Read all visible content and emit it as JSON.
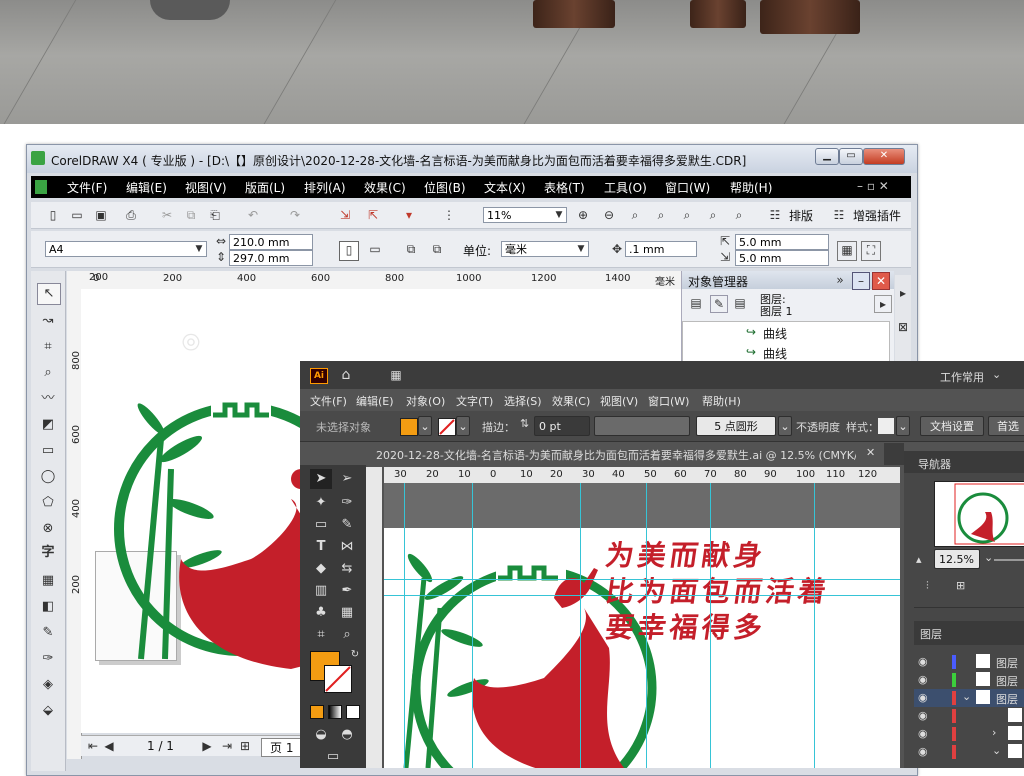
{
  "corel": {
    "title": "CorelDRAW X4 ( 专业版 ) - [D:\\【】原创设计\\2020-12-28-文化墙-名言标语-为美而献身比为面包而活着要幸福得多爱默生.CDR]",
    "menu": [
      "文件(F)",
      "编辑(E)",
      "视图(V)",
      "版面(L)",
      "排列(A)",
      "效果(C)",
      "位图(B)",
      "文本(X)",
      "表格(T)",
      "工具(O)",
      "窗口(W)",
      "帮助(H)"
    ],
    "zoom": "11%",
    "arrange_label": "排版",
    "plugin_label": "增强插件",
    "page_size": "A4",
    "width": "210.0 mm",
    "height": "297.0 mm",
    "unit_label": "单位:",
    "unit_value": "毫米",
    "nudge": ".1 mm",
    "dup_x": "5.0 mm",
    "dup_y": "5.0 mm",
    "ruler_ticks": [
      "200",
      "0",
      "200",
      "400",
      "600",
      "800",
      "1000",
      "1200",
      "1400",
      "毫米"
    ],
    "ruler_v_ticks": [
      "800",
      "600",
      "400",
      "200"
    ],
    "text_tool": "字",
    "page_status": "1 / 1",
    "page_tab": "页 1",
    "docker": {
      "title": "对象管理器",
      "layer_line1": "图层:",
      "layer_line2": "图层 1",
      "items": [
        "曲线",
        "曲线"
      ]
    }
  },
  "ai": {
    "logo": "Ai",
    "workspace": "工作常用",
    "menu": [
      "文件(F)",
      "编辑(E)",
      "对象(O)",
      "文字(T)",
      "选择(S)",
      "效果(C)",
      "视图(V)",
      "窗口(W)",
      "帮助(H)"
    ],
    "no_selection": "未选择对象",
    "stroke_label": "描边：",
    "stroke_value": "0 pt",
    "brush": "5 点圆形",
    "opacity_label": "不透明度",
    "style_label": "样式：",
    "doc_settings": "文档设置",
    "prefs": "首选",
    "doc_tab": "2020-12-28-文化墙-名言标语-为美而献身比为面包而活着要幸福得多爱默生.ai @ 12.5% (CMYK/...",
    "ruler_ticks": [
      "30",
      "20",
      "10",
      "0",
      "10",
      "20",
      "30",
      "40",
      "50",
      "60",
      "70",
      "80",
      "90",
      "100",
      "110",
      "120"
    ],
    "navigator_title": "导航器",
    "nav_zoom": "12.5%",
    "layers_title": "图层",
    "layer_rows": [
      "图层",
      "图层",
      "图层"
    ]
  },
  "artwork": {
    "lines": [
      "为美而献身",
      "比为面包而活着",
      "要幸福得多"
    ],
    "colors": {
      "green": "#1a8c3c",
      "red": "#c41f2a",
      "swatch": "#f39c12"
    }
  }
}
